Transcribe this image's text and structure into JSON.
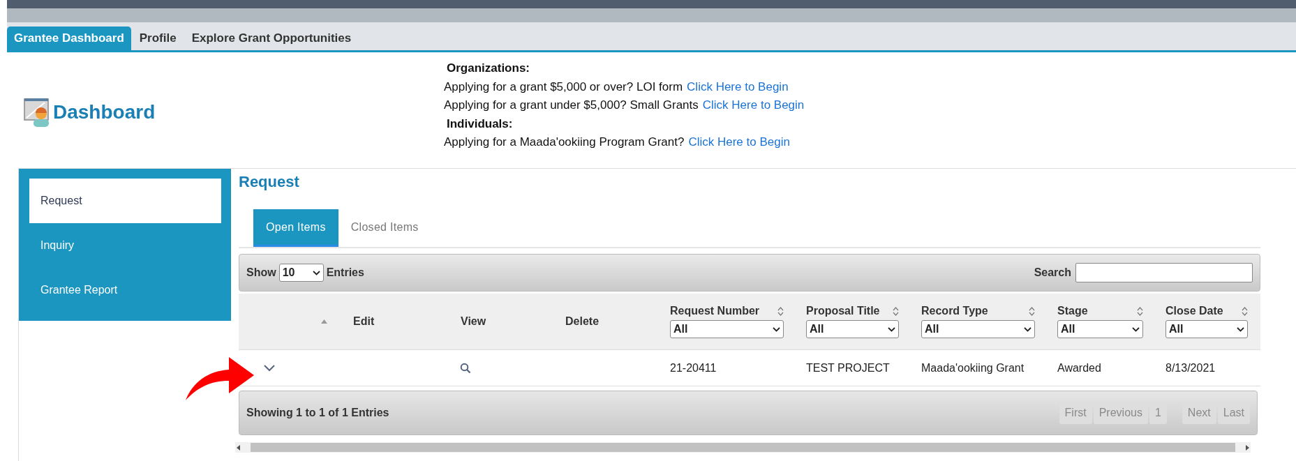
{
  "top_nav": {
    "tabs": [
      {
        "label": "Grantee Dashboard",
        "selected": true
      },
      {
        "label": "Profile",
        "selected": false
      },
      {
        "label": "Explore Grant Opportunities",
        "selected": false
      }
    ]
  },
  "header": {
    "title": "Dashboard",
    "sections": [
      {
        "heading": "Organizations:",
        "lines": [
          {
            "text": "Applying for a grant $5,000 or over? LOI form",
            "link": "Click Here to Begin"
          },
          {
            "text": "Applying for a grant under $5,000? Small Grants",
            "link": "Click Here to Begin"
          }
        ]
      },
      {
        "heading": "Individuals:",
        "lines": [
          {
            "text": "Applying for a Maada'ookiing Program Grant?",
            "link": "Click Here to Begin"
          }
        ]
      }
    ]
  },
  "sidebar": {
    "items": [
      {
        "label": "Request",
        "selected": true
      },
      {
        "label": "Inquiry",
        "selected": false
      },
      {
        "label": "Grantee Report",
        "selected": false
      }
    ]
  },
  "content": {
    "title": "Request",
    "tabs": [
      {
        "label": "Open Items",
        "selected": true
      },
      {
        "label": "Closed Items",
        "selected": false
      }
    ],
    "table": {
      "show_label": "Show",
      "page_length": "10",
      "entries_label": "Entries",
      "search_label": "Search",
      "columns": [
        {
          "kind": "expander",
          "sorted": true
        },
        {
          "kind": "text",
          "label": "Edit"
        },
        {
          "kind": "text",
          "label": "View"
        },
        {
          "kind": "text",
          "label": "Delete"
        },
        {
          "kind": "filter",
          "label": "Request Number",
          "sorted": false,
          "filter": "All"
        },
        {
          "kind": "filter",
          "label": "Proposal Title",
          "sorted": false,
          "filter": "All"
        },
        {
          "kind": "filter",
          "label": "Record Type",
          "sorted": false,
          "filter": "All"
        },
        {
          "kind": "filter",
          "label": "Stage",
          "sorted": false,
          "filter": "All"
        },
        {
          "kind": "filter",
          "label": "Close Date",
          "sorted": false,
          "filter": "All"
        }
      ],
      "rows": [
        {
          "expanded": false,
          "values": [
            "21-20411",
            "TEST PROJECT",
            "Maada'ookiing Grant",
            "Awarded",
            "8/13/2021"
          ]
        }
      ],
      "info": "Showing 1 to 1 of 1 Entries",
      "pagination": [
        {
          "label": "First",
          "disabled": true
        },
        {
          "label": "Previous",
          "disabled": true
        },
        {
          "label": "1",
          "disabled": true
        },
        {
          "label": "Next",
          "disabled": true
        },
        {
          "label": "Last",
          "disabled": true
        }
      ]
    }
  }
}
